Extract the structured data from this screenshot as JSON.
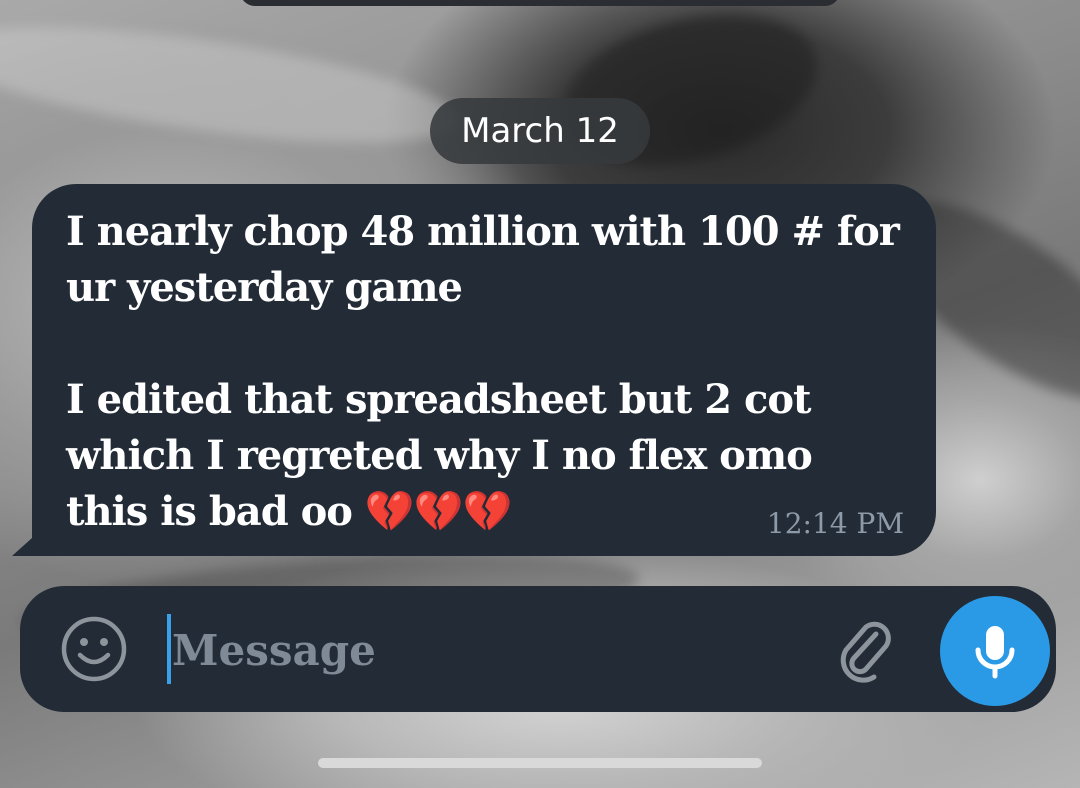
{
  "chat": {
    "date_separator": "March 12",
    "messages": [
      {
        "paragraph_1": "I nearly chop 48 million with 100 # for ur yesterday game",
        "paragraph_2": "I edited that spreadsheet but 2 cot which I regreted why I no flex omo this is bad oo 💔💔💔",
        "time": "12:14 PM"
      }
    ]
  },
  "composer": {
    "placeholder": "Message",
    "value": "",
    "emoji_icon": "smiley-face-icon",
    "attach_icon": "paperclip-icon",
    "mic_icon": "microphone-icon"
  },
  "colors": {
    "bubble": "#222b36",
    "composer": "#222b36",
    "mic_button": "#2b9ae6",
    "timestamp": "#8e9aa8",
    "placeholder": "#7f8a96",
    "caret": "#3aa0e8"
  }
}
